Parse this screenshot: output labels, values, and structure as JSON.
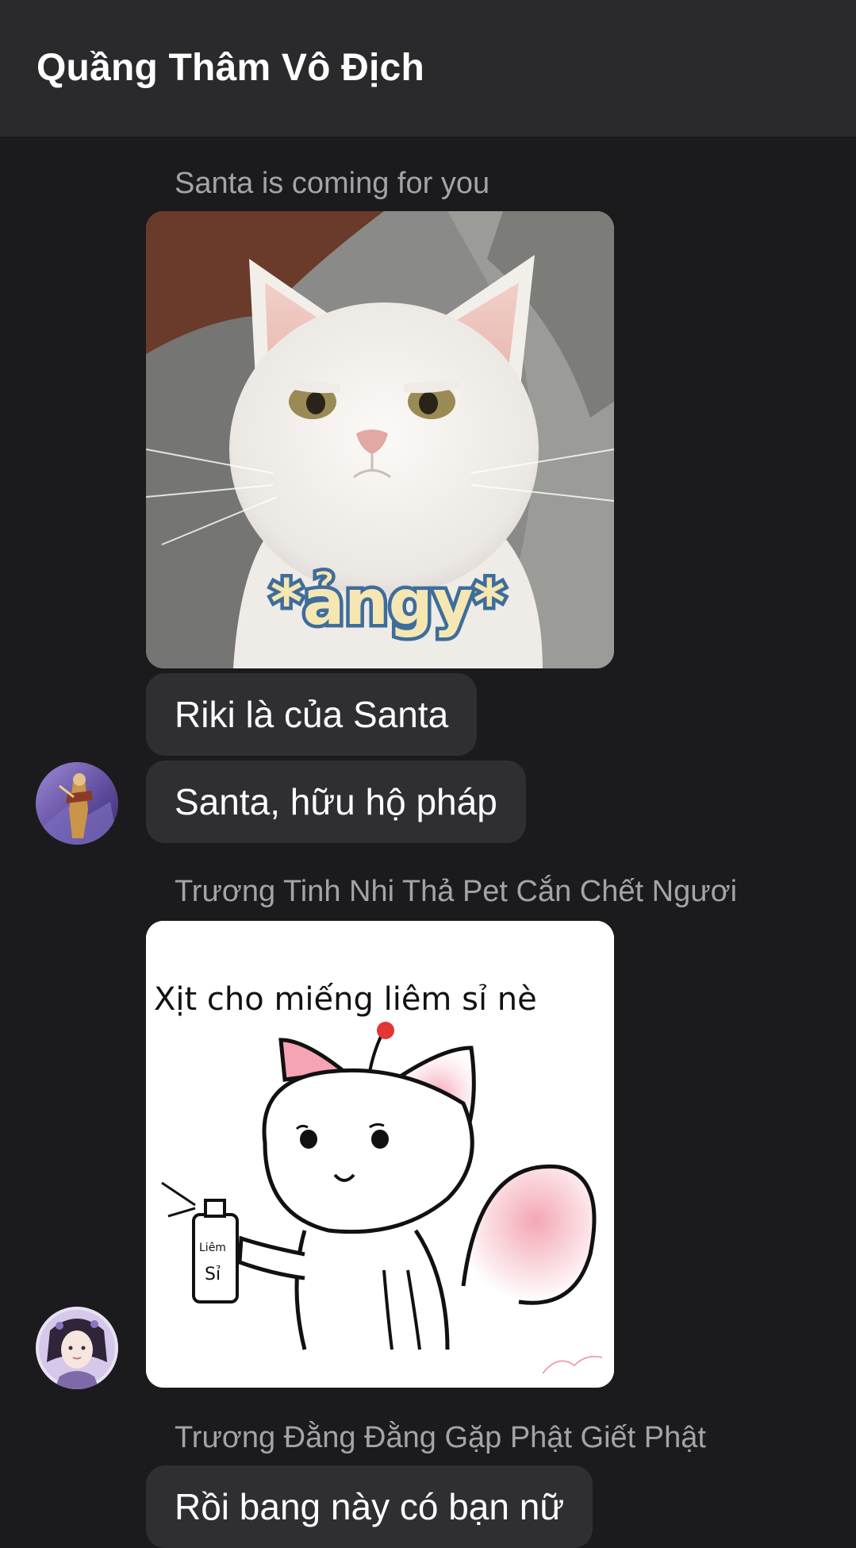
{
  "header": {
    "title": "Quầng Thâm Vô Địch"
  },
  "messages": [
    {
      "sender": "Santa is coming for you",
      "image_caption": "*ảngy*",
      "bubbles": [
        "Riki là của Santa",
        "Santa, hữu hộ pháp"
      ]
    },
    {
      "sender": "Trương Tinh Nhi Thả Pet Cắn Chết Ngươi",
      "image_caption": "Xịt cho miếng liêm sỉ nè",
      "can_label_1": "Liêm",
      "can_label_2": "Sỉ"
    },
    {
      "sender": "Trương Đằng Đằng Gặp Phật Giết Phật",
      "bubbles": [
        "Rồi bang này có bạn nữ"
      ]
    }
  ],
  "colors": {
    "background": "#1b1b1e",
    "header": "#2a2a2d",
    "bubble": "#2f2f33",
    "sender_text": "#a3a3a8"
  }
}
